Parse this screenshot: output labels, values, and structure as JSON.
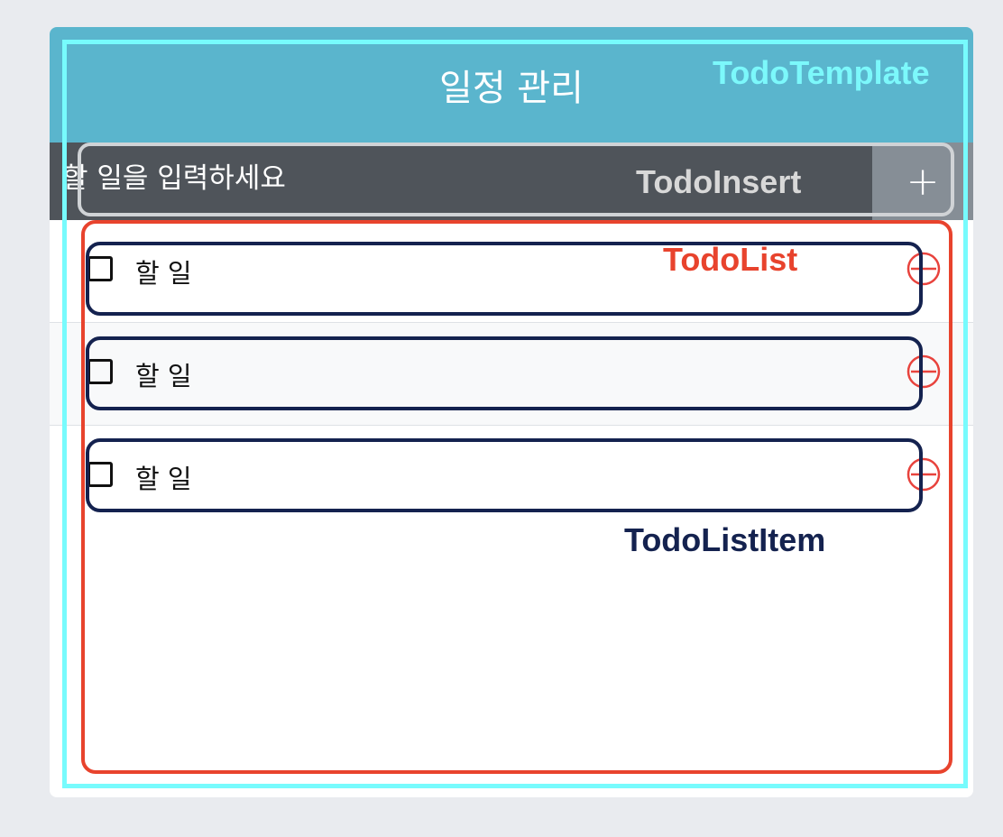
{
  "header": {
    "title": "일정 관리"
  },
  "insert": {
    "placeholder": "할 일을 입력하세요",
    "add_label": "+"
  },
  "todos": [
    {
      "text": "할 일",
      "checked": false
    },
    {
      "text": "할 일",
      "checked": false
    },
    {
      "text": "할 일",
      "checked": false
    }
  ],
  "annotations": {
    "template": "TodoTemplate",
    "insert": "TodoInsert",
    "list": "TodoList",
    "list_item": "TodoListItem"
  },
  "colors": {
    "header_bg": "#5ab5cd",
    "insert_bg": "#4f545a",
    "add_button_bg": "#868e96",
    "remove_icon": "#e8433d",
    "template_frame": "#77fbfd",
    "list_frame": "#e8432d",
    "item_frame": "#14224f"
  }
}
